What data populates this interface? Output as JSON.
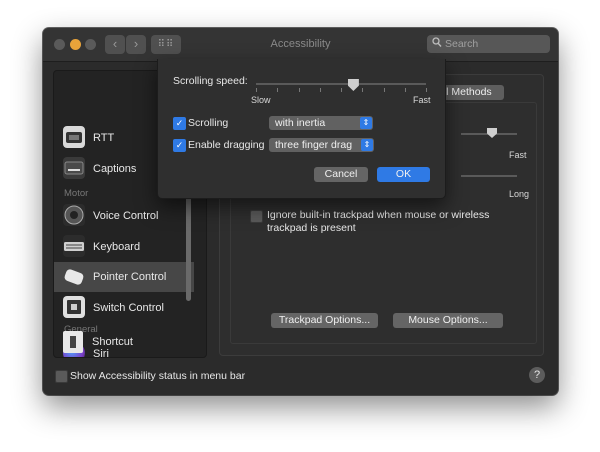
{
  "window": {
    "title": "Accessibility",
    "nav_back": "‹",
    "nav_forward": "›",
    "grid_icon": "show-all-grid",
    "search_placeholder": "Search"
  },
  "sidebar": {
    "items": [
      {
        "label": "RTT",
        "icon": "rtt-icon"
      },
      {
        "label": "Captions",
        "icon": "captions-icon"
      },
      {
        "label": "Voice Control",
        "icon": "voice-control-icon"
      },
      {
        "label": "Keyboard",
        "icon": "keyboard-icon"
      },
      {
        "label": "Pointer Control",
        "icon": "pointer-control-icon",
        "selected": true
      },
      {
        "label": "Switch Control",
        "icon": "switch-control-icon"
      },
      {
        "label": "Siri",
        "icon": "siri-icon"
      },
      {
        "label": "Shortcut",
        "icon": "shortcut-icon"
      }
    ],
    "section_motor": "Motor",
    "section_general": "General"
  },
  "content": {
    "tab_label": "ol Methods",
    "fast_label": "Fast",
    "long_label": "Long",
    "ignore_trackpad_line1": "Ignore built-in trackpad when mouse or wireless",
    "ignore_trackpad_line2": "trackpad is present",
    "trackpad_options": "Trackpad Options...",
    "mouse_options": "Mouse Options..."
  },
  "footer": {
    "show_status": "Show Accessibility status in menu bar",
    "help": "?"
  },
  "sheet": {
    "scrolling_speed_label": "Scrolling speed:",
    "slow": "Slow",
    "fast": "Fast",
    "scrolling_label": "Scrolling",
    "scrolling_value": "with inertia",
    "dragging_label": "Enable dragging",
    "dragging_value": "three finger drag",
    "cancel": "Cancel",
    "ok": "OK",
    "scrolling_speed_fraction": 0.57
  },
  "colors": {
    "accent": "#2f7ae5",
    "window_bg": "#2b2b2b",
    "minimize_light": "#e9a33a"
  }
}
